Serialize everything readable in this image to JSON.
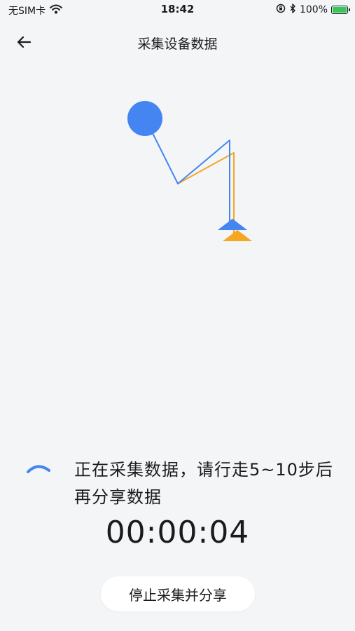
{
  "status_bar": {
    "carrier": "无SIM卡",
    "time": "18:42",
    "battery_percent": "100%",
    "battery_level": 1.0,
    "battery_color": "#34c759",
    "icons": [
      "wifi-icon",
      "orientation-lock-icon",
      "bluetooth-icon",
      "battery-icon"
    ]
  },
  "header": {
    "title": "采集设备数据",
    "back_icon": "arrow-left-icon"
  },
  "figure": {
    "colors": {
      "primary": "#4485f2",
      "secondary": "#f5a623"
    }
  },
  "collecting": {
    "message": "正在采集数据，请行走5~10步后再分享数据",
    "elapsed": "00:00:04",
    "spinner_icon": "loading-spinner-icon"
  },
  "actions": {
    "stop_share_label": "停止采集并分享"
  }
}
